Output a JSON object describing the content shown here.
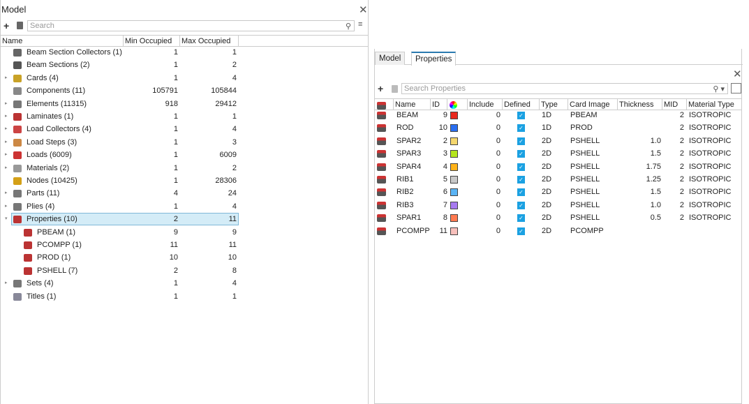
{
  "model_panel": {
    "title": "Model",
    "search_placeholder": "Search",
    "columns": [
      "Name",
      "Min Occupied",
      "Max Occupied"
    ],
    "rows": [
      {
        "name": "Beam Section Collectors  (1)",
        "min": "1",
        "max": "1",
        "expand": false,
        "level": 0,
        "color": "#666"
      },
      {
        "name": "Beam Sections  (2)",
        "min": "1",
        "max": "2",
        "expand": false,
        "level": 0,
        "color": "#555"
      },
      {
        "name": "Cards  (4)",
        "min": "1",
        "max": "4",
        "expand": true,
        "level": 0,
        "color": "#c9a227"
      },
      {
        "name": "Components  (11)",
        "min": "105791",
        "max": "105844",
        "expand": false,
        "level": 0,
        "color": "#888"
      },
      {
        "name": "Elements  (11315)",
        "min": "918",
        "max": "29412",
        "expand": true,
        "level": 0,
        "color": "#777"
      },
      {
        "name": "Laminates  (1)",
        "min": "1",
        "max": "1",
        "expand": true,
        "level": 0,
        "color": "#b33"
      },
      {
        "name": "Load Collectors  (4)",
        "min": "1",
        "max": "4",
        "expand": true,
        "level": 0,
        "color": "#c44"
      },
      {
        "name": "Load Steps  (3)",
        "min": "1",
        "max": "3",
        "expand": true,
        "level": 0,
        "color": "#c84"
      },
      {
        "name": "Loads  (6009)",
        "min": "1",
        "max": "6009",
        "expand": true,
        "level": 0,
        "color": "#c33"
      },
      {
        "name": "Materials  (2)",
        "min": "1",
        "max": "2",
        "expand": true,
        "level": 0,
        "color": "#999"
      },
      {
        "name": "Nodes  (10425)",
        "min": "1",
        "max": "28306",
        "expand": false,
        "level": 0,
        "color": "#d4a017"
      },
      {
        "name": "Parts  (11)",
        "min": "4",
        "max": "24",
        "expand": true,
        "level": 0,
        "color": "#777"
      },
      {
        "name": "Plies  (4)",
        "min": "1",
        "max": "4",
        "expand": true,
        "level": 0,
        "color": "#777"
      },
      {
        "name": "Properties  (10)",
        "min": "2",
        "max": "11",
        "expand": true,
        "open": true,
        "level": 0,
        "color": "#b33",
        "selected": true
      },
      {
        "name": "PBEAM  (1)",
        "min": "9",
        "max": "9",
        "expand": false,
        "level": 1,
        "color": "#b33"
      },
      {
        "name": "PCOMPP  (1)",
        "min": "11",
        "max": "11",
        "expand": false,
        "level": 1,
        "color": "#b33"
      },
      {
        "name": "PROD  (1)",
        "min": "10",
        "max": "10",
        "expand": false,
        "level": 1,
        "color": "#b33"
      },
      {
        "name": "PSHELL  (7)",
        "min": "2",
        "max": "8",
        "expand": false,
        "level": 1,
        "color": "#b33"
      },
      {
        "name": "Sets  (4)",
        "min": "1",
        "max": "4",
        "expand": true,
        "level": 0,
        "color": "#777"
      },
      {
        "name": "Titles  (1)",
        "min": "1",
        "max": "1",
        "expand": false,
        "level": 0,
        "color": "#889"
      }
    ]
  },
  "properties_panel": {
    "tabs": [
      "Model",
      "Properties"
    ],
    "active_tab": "Properties",
    "search_placeholder": "Search Properties",
    "columns": [
      "Name",
      "ID",
      "",
      "Include",
      "Defined",
      "Type",
      "Card Image",
      "Thickness",
      "MID",
      "Material Type"
    ],
    "rows": [
      {
        "name": "BEAM",
        "id": "9",
        "color": "#e8281e",
        "include": "0",
        "defined": true,
        "type": "1D",
        "card": "PBEAM",
        "thickness": "",
        "mid": "2",
        "mat": "ISOTROPIC"
      },
      {
        "name": "ROD",
        "id": "10",
        "color": "#2a6ef0",
        "include": "0",
        "defined": true,
        "type": "1D",
        "card": "PROD",
        "thickness": "",
        "mid": "2",
        "mat": "ISOTROPIC"
      },
      {
        "name": "SPAR2",
        "id": "2",
        "color": "#f5d76e",
        "include": "0",
        "defined": true,
        "type": "2D",
        "card": "PSHELL",
        "thickness": "1.0",
        "mid": "2",
        "mat": "ISOTROPIC"
      },
      {
        "name": "SPAR3",
        "id": "3",
        "color": "#b5e61d",
        "include": "0",
        "defined": true,
        "type": "2D",
        "card": "PSHELL",
        "thickness": "1.5",
        "mid": "2",
        "mat": "ISOTROPIC"
      },
      {
        "name": "SPAR4",
        "id": "4",
        "color": "#ffb319",
        "include": "0",
        "defined": true,
        "type": "2D",
        "card": "PSHELL",
        "thickness": "1.75",
        "mid": "2",
        "mat": "ISOTROPIC"
      },
      {
        "name": "RIB1",
        "id": "5",
        "color": "#c8c8c8",
        "include": "0",
        "defined": true,
        "type": "2D",
        "card": "PSHELL",
        "thickness": "1.25",
        "mid": "2",
        "mat": "ISOTROPIC"
      },
      {
        "name": "RIB2",
        "id": "6",
        "color": "#5ab4f5",
        "include": "0",
        "defined": true,
        "type": "2D",
        "card": "PSHELL",
        "thickness": "1.5",
        "mid": "2",
        "mat": "ISOTROPIC"
      },
      {
        "name": "RIB3",
        "id": "7",
        "color": "#a77af0",
        "include": "0",
        "defined": true,
        "type": "2D",
        "card": "PSHELL",
        "thickness": "1.0",
        "mid": "2",
        "mat": "ISOTROPIC"
      },
      {
        "name": "SPAR1",
        "id": "8",
        "color": "#ff7a50",
        "include": "0",
        "defined": true,
        "type": "2D",
        "card": "PSHELL",
        "thickness": "0.5",
        "mid": "2",
        "mat": "ISOTROPIC"
      },
      {
        "name": "PCOMPP",
        "id": "11",
        "color": "#f8c0bc",
        "include": "0",
        "defined": true,
        "type": "2D",
        "card": "PCOMPP",
        "thickness": "",
        "mid": "",
        "mat": ""
      }
    ]
  }
}
